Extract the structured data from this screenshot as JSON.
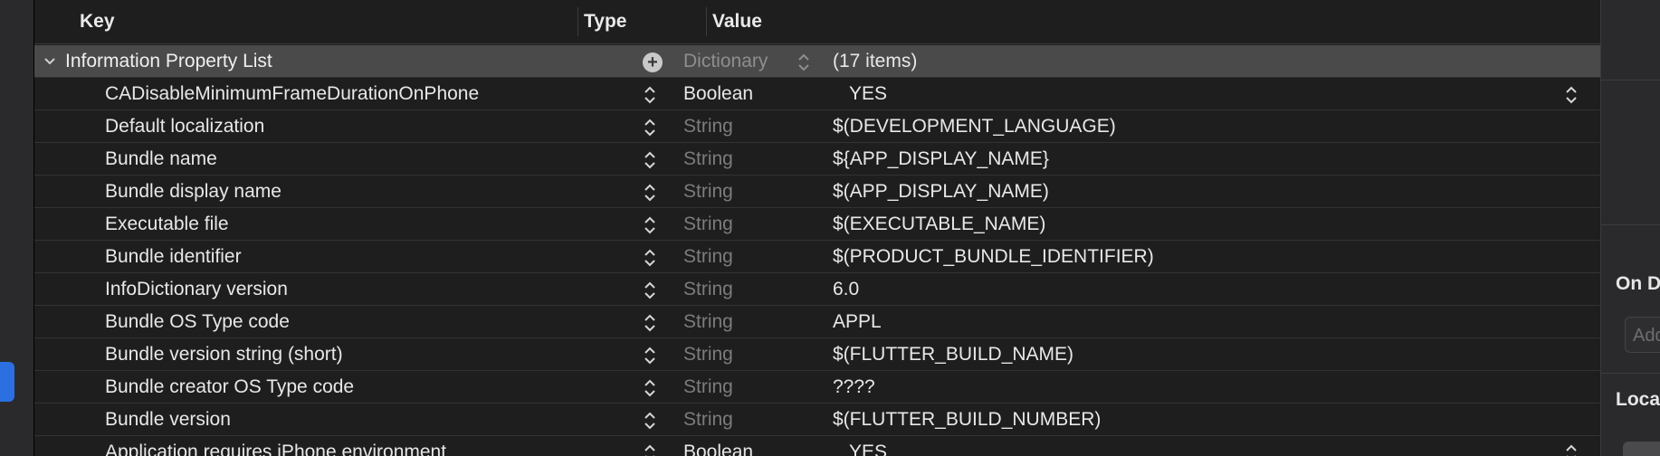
{
  "header": {
    "key": "Key",
    "type": "Type",
    "value": "Value"
  },
  "root": {
    "key": "Information Property List",
    "type": "Dictionary",
    "value": "(17 items)"
  },
  "rows": [
    {
      "key": "CADisableMinimumFrameDurationOnPhone",
      "type": "Boolean",
      "value": "YES"
    },
    {
      "key": "Default localization",
      "type": "String",
      "value": "$(DEVELOPMENT_LANGUAGE)"
    },
    {
      "key": "Bundle name",
      "type": "String",
      "value": "${APP_DISPLAY_NAME}"
    },
    {
      "key": "Bundle display name",
      "type": "String",
      "value": "$(APP_DISPLAY_NAME)"
    },
    {
      "key": "Executable file",
      "type": "String",
      "value": "$(EXECUTABLE_NAME)"
    },
    {
      "key": "Bundle identifier",
      "type": "String",
      "value": "$(PRODUCT_BUNDLE_IDENTIFIER)"
    },
    {
      "key": "InfoDictionary version",
      "type": "String",
      "value": "6.0"
    },
    {
      "key": "Bundle OS Type code",
      "type": "String",
      "value": "APPL"
    },
    {
      "key": "Bundle version string (short)",
      "type": "String",
      "value": "$(FLUTTER_BUILD_NAME)"
    },
    {
      "key": "Bundle creator OS Type code",
      "type": "String",
      "value": "????"
    },
    {
      "key": "Bundle version",
      "type": "String",
      "value": "$(FLUTTER_BUILD_NUMBER)"
    },
    {
      "key": "Application requires iPhone environment",
      "type": "Boolean",
      "value": "YES"
    }
  ],
  "inspector": {
    "section1": "On D",
    "add_placeholder": "Add",
    "section2": "Loca"
  },
  "colors": {
    "root_row_bg": "#4a4a4a",
    "accent": "#2b6fe0",
    "muted_type": "#7c7c7c"
  }
}
